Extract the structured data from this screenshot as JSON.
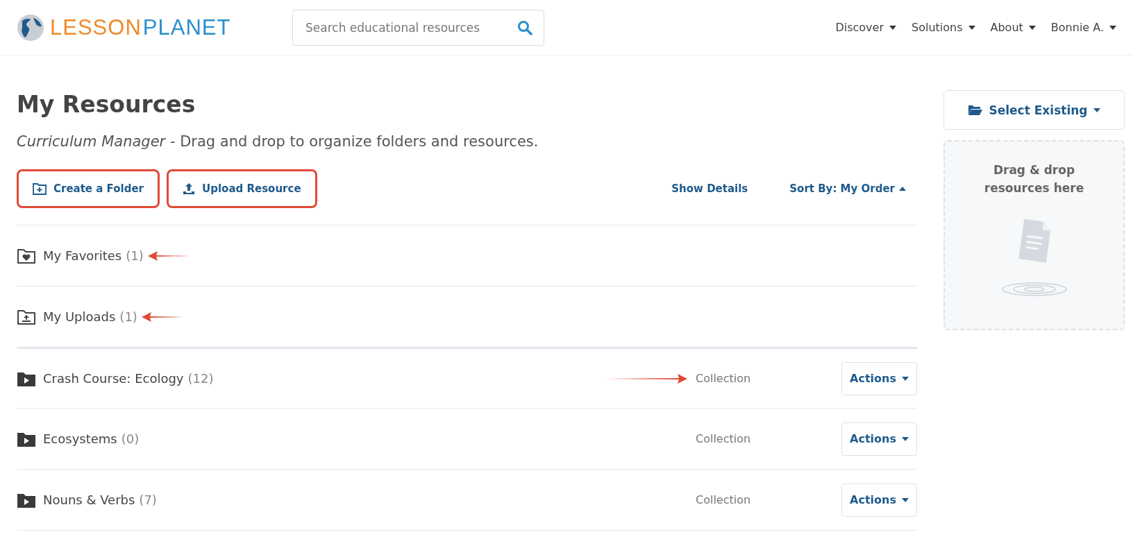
{
  "header": {
    "logo": {
      "word_1": "LESSON",
      "word_2": "PLANET"
    },
    "search": {
      "placeholder": "Search educational resources"
    },
    "nav": [
      "Discover",
      "Solutions",
      "About",
      "Bonnie A."
    ]
  },
  "page": {
    "title": "My Resources",
    "subtitle": {
      "lead": "Curriculum Manager",
      "text": " - Drag and drop to organize folders and resources."
    },
    "buttons": [
      {
        "kind": "create",
        "label": "Create a Folder",
        "highlighted": true
      },
      {
        "kind": "upload",
        "label": "Upload Resource",
        "highlighted": true
      }
    ],
    "show_details": "Show Details",
    "sort": "Sort By: My Order",
    "folders": [
      {
        "kind": "favorites",
        "name": "My Favorites",
        "count": "(1)",
        "arrow": true
      },
      {
        "kind": "uploads",
        "name": "My Uploads",
        "count": "(1)",
        "arrow": true
      }
    ],
    "collections": [
      {
        "name": "Crash Course: Ecology",
        "count": "(12)",
        "type": "Collection",
        "actions": "Actions",
        "arrow": true
      },
      {
        "name": "Ecosystems",
        "count": "(0)",
        "type": "Collection",
        "actions": "Actions",
        "arrow": false
      },
      {
        "name": "Nouns & Verbs",
        "count": "(7)",
        "type": "Collection",
        "actions": "Actions",
        "arrow": false
      }
    ]
  },
  "sidebar": {
    "select_existing": "Select Existing",
    "dropzone": "Drag & drop resources here"
  }
}
